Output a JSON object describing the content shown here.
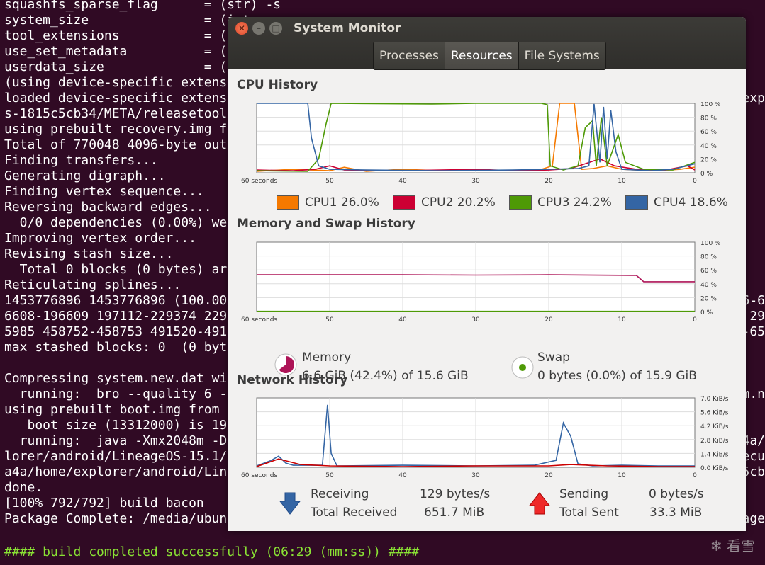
{
  "terminal": {
    "lines": [
      {
        "text": "squashfs_sparse_flag      = (str) -s",
        "color": "white"
      },
      {
        "text": "system_size               = (int",
        "color": "white"
      },
      {
        "text": "tool_extensions           = (",
        "color": "white"
      },
      {
        "text": "use_set_metadata          = (",
        "color": "white"
      },
      {
        "text": "userdata_size             = (",
        "color": "white"
      },
      {
        "text": "(using device-specific extens",
        "color": "white"
      },
      {
        "text": "loaded device-specific extens",
        "color": "white"
      },
      {
        "text": "s-1815c5cb34/META/releasetool",
        "color": "white"
      },
      {
        "text": "using prebuilt recovery.img f",
        "color": "white"
      },
      {
        "text": "Total of 770048 4096-byte out",
        "color": "white"
      },
      {
        "text": "Finding transfers...",
        "color": "white"
      },
      {
        "text": "Generating digraph...",
        "color": "white"
      },
      {
        "text": "Finding vertex sequence...",
        "color": "white"
      },
      {
        "text": "Reversing backward edges...",
        "color": "white"
      },
      {
        "text": "  0/0 dependencies (0.00%) we",
        "color": "white"
      },
      {
        "text": "Improving vertex order...",
        "color": "white"
      },
      {
        "text": "Revising stash size...",
        "color": "white"
      },
      {
        "text": "  Total 0 blocks (0 bytes) ar",
        "color": "white"
      },
      {
        "text": "Reticulating splines...",
        "color": "white"
      },
      {
        "text": "1453776896 1453776896 (100.00",
        "color": "white"
      },
      {
        "text": "6608-196609 197112-229374 229",
        "color": "white"
      },
      {
        "text": "5985 458752-458753 491520-491",
        "color": "white"
      },
      {
        "text": "max stashed blocks: 0  (0 byt",
        "color": "white"
      },
      {
        "text": "",
        "color": "white"
      },
      {
        "text": "Compressing system.new.dat wi",
        "color": "white"
      },
      {
        "text": "  running:  bro --quality 6 -",
        "color": "white"
      },
      {
        "text": "using prebuilt boot.img from ",
        "color": "white"
      },
      {
        "text": "   boot size (13312000) is 19",
        "color": "white"
      },
      {
        "text": "  running:  java -Xmx2048m -D",
        "color": "white"
      },
      {
        "text": "lorer/android/LineageOS-15.1/",
        "color": "white"
      },
      {
        "text": "a4a/home/explorer/android/Lin",
        "color": "white"
      },
      {
        "text": "done.",
        "color": "white"
      },
      {
        "text": "[100% 792/792] build bacon",
        "color": "white"
      },
      {
        "text": "Package Complete: /media/ubun",
        "color": "white"
      },
      {
        "text": "",
        "color": "white"
      },
      {
        "text": "#### build completed successfully (06:29 (mm:ss)) ####",
        "color": "green"
      }
    ],
    "right_fragments": [
      {
        "row": 6,
        "text": "exp"
      },
      {
        "row": 19,
        "text": "6-6"
      },
      {
        "row": 20,
        "text": "29"
      },
      {
        "row": 21,
        "text": "-65"
      },
      {
        "row": 25,
        "text": "m.n"
      },
      {
        "row": 28,
        "text": "4a/"
      },
      {
        "row": 29,
        "text": "ecu"
      },
      {
        "row": 30,
        "text": "5cb"
      },
      {
        "row": 33,
        "text": "age"
      }
    ],
    "watermark": "❄ 看雪"
  },
  "window": {
    "title": "System Monitor",
    "tabs": [
      {
        "label": "Processes",
        "active": false
      },
      {
        "label": "Resources",
        "active": true
      },
      {
        "label": "File Systems",
        "active": false
      }
    ],
    "cpu": {
      "title": "CPU History",
      "legend": [
        {
          "label": "CPU1 26.0%",
          "color": "#f57900"
        },
        {
          "label": "CPU2 20.2%",
          "color": "#cc0033"
        },
        {
          "label": "CPU3 24.2%",
          "color": "#4e9a06"
        },
        {
          "label": "CPU4 18.6%",
          "color": "#3465a4"
        }
      ]
    },
    "memory": {
      "title": "Memory and Swap History",
      "memory_label": "Memory",
      "memory_value": "6.6 GiB (42.4%) of 15.6 GiB",
      "swap_label": "Swap",
      "swap_value": "0 bytes (0.0%) of 15.9 GiB",
      "memory_color": "#ad1457",
      "swap_color": "#4e9a06"
    },
    "network": {
      "title": "Network History",
      "receiving_label": "Receiving",
      "receiving_value": "129 bytes/s",
      "total_received_label": "Total Received",
      "total_received_value": "651.7 MiB",
      "sending_label": "Sending",
      "sending_value": "0 bytes/s",
      "total_sent_label": "Total Sent",
      "total_sent_value": "33.3 MiB"
    },
    "percent_ticks": [
      "100 %",
      "80 %",
      "60 %",
      "40 %",
      "20 %",
      "0 %"
    ],
    "net_ticks": [
      "7.0 KiB/s",
      "5.6 KiB/s",
      "4.2 KiB/s",
      "2.8 KiB/s",
      "1.4 KiB/s",
      "0.0 KiB/s"
    ],
    "time_ticks": [
      "60 seconds",
      "50",
      "40",
      "30",
      "20",
      "10",
      "0"
    ]
  }
}
